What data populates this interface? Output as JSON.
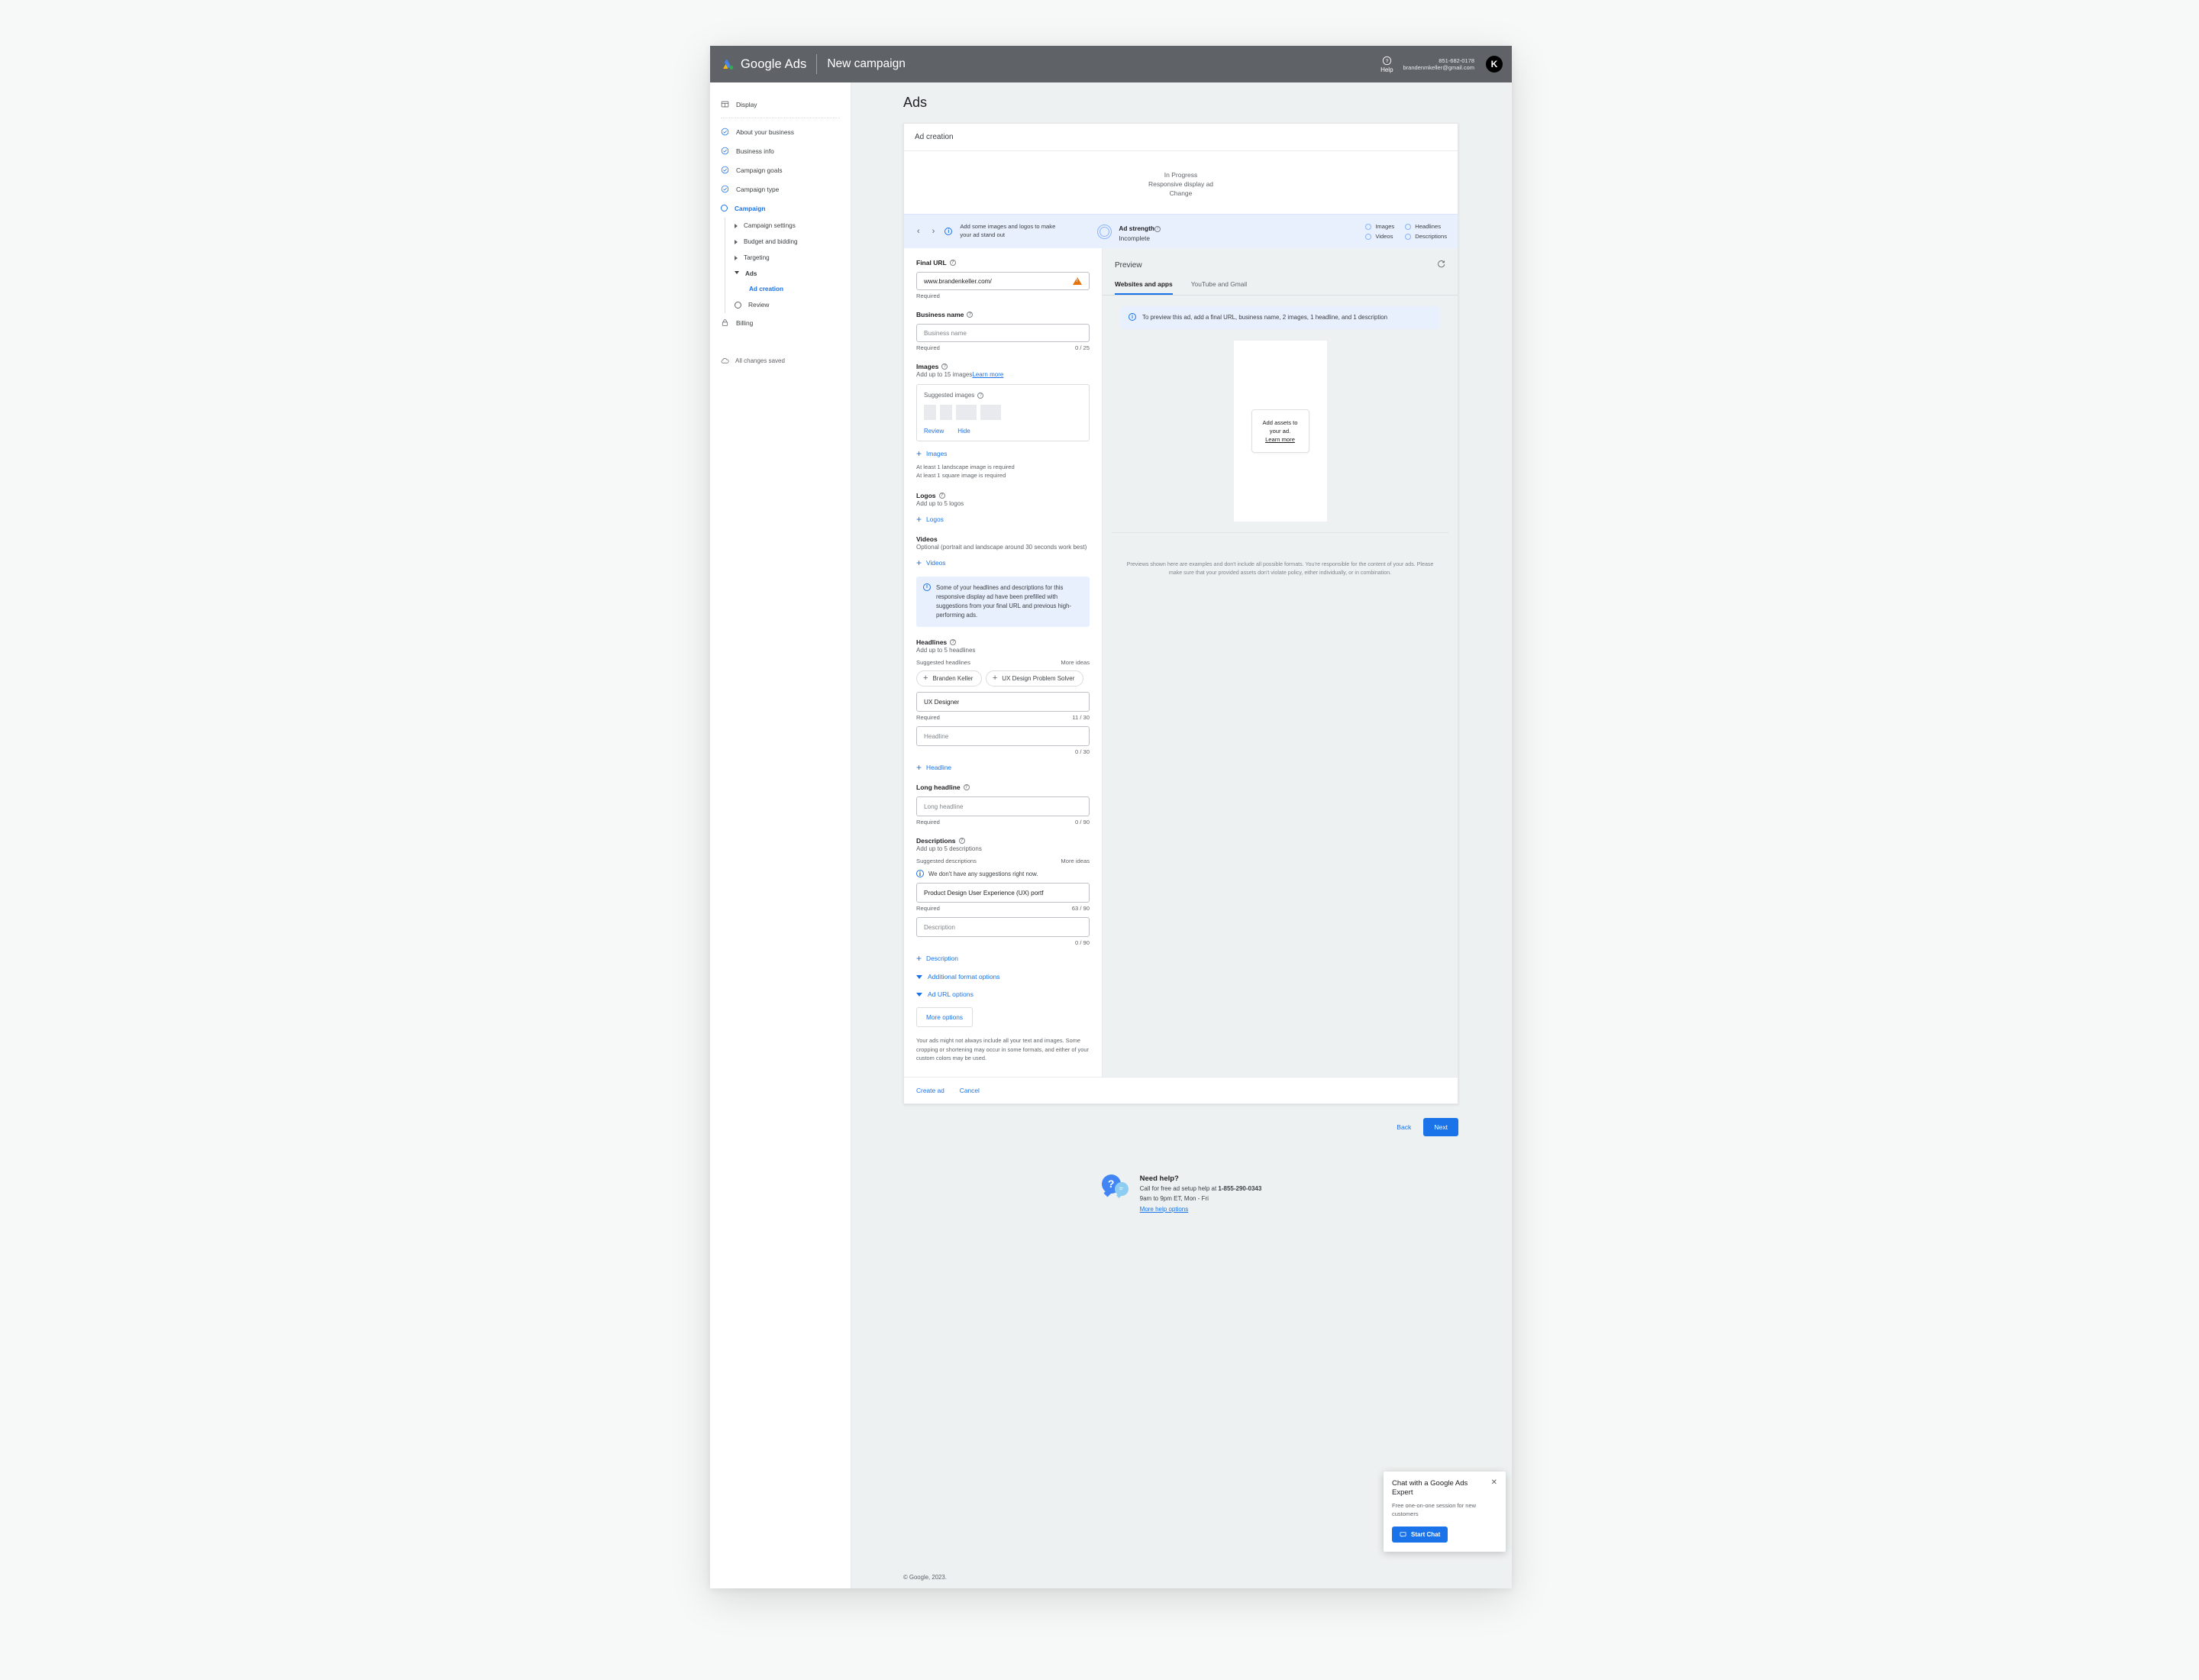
{
  "topbar": {
    "brand_google": "Google",
    "brand_ads": "Ads",
    "campaign_title": "New campaign",
    "help_label": "Help",
    "phone": "851-682-0178",
    "email": "brandenmkeller@gmail.com",
    "avatar_initial": "K"
  },
  "sidebar": {
    "display": "Display",
    "items": [
      {
        "label": "About your business",
        "icon": "check-circle-icon",
        "state": "complete"
      },
      {
        "label": "Business info",
        "icon": "check-circle-icon",
        "state": "complete"
      },
      {
        "label": "Campaign goals",
        "icon": "check-circle-icon",
        "state": "complete"
      },
      {
        "label": "Campaign type",
        "icon": "check-circle-icon",
        "state": "complete"
      },
      {
        "label": "Campaign",
        "icon": "circle-icon",
        "state": "active"
      }
    ],
    "sub_items": [
      {
        "label": "Campaign settings"
      },
      {
        "label": "Budget and bidding"
      },
      {
        "label": "Targeting"
      },
      {
        "label": "Ads"
      }
    ],
    "sub_child": "Ad creation",
    "review": "Review",
    "billing": "Billing",
    "saved_status": "All changes saved"
  },
  "main": {
    "page_title": "Ads",
    "card_title": "Ad creation",
    "status_progress": "In Progress",
    "status_type": "Responsive display ad",
    "status_change": "Change",
    "strength": {
      "message": "Add some images and logos to make your ad stand out",
      "title": "Ad strength",
      "value": "Incomplete",
      "checks": [
        "Images",
        "Headlines",
        "Videos",
        "Descriptions"
      ]
    }
  },
  "form": {
    "final_url_label": "Final URL",
    "final_url_value": "www.brandenkeller.com/",
    "final_url_required": "Required",
    "business_name_label": "Business name",
    "business_name_placeholder": "Business name",
    "business_name_required": "Required",
    "business_name_count": "0 / 25",
    "images_label": "Images",
    "images_sub": "Add up to 15 images",
    "images_learn_more": "Learn more",
    "suggested_images_label": "Suggested images",
    "suggested_review": "Review",
    "suggested_hide": "Hide",
    "add_images": "Images",
    "images_hint_1": "At least 1 landscape image is required",
    "images_hint_2": "At least 1 square image is required",
    "logos_label": "Logos",
    "logos_sub": "Add up to 5 logos",
    "add_logos": "Logos",
    "videos_label": "Videos",
    "videos_sub": "Optional (portrait and landscape around 30 seconds work best)",
    "add_videos": "Videos",
    "prefill_notice": "Some of your headlines and descriptions for this responsive display ad have been prefilled with suggestions from your final URL and previous high-performing ads.",
    "headlines_label": "Headlines",
    "headlines_sub": "Add up to 5 headlines",
    "suggested_headlines_label": "Suggested headlines",
    "more_ideas": "More ideas",
    "headline_chips": [
      "Branden Keller",
      "UX Design Problem Solver"
    ],
    "headline_value": "UX Designer",
    "headline_required": "Required",
    "headline_count": "11 / 30",
    "headline_placeholder": "Headline",
    "headline_empty_count": "0 / 30",
    "add_headline": "Headline",
    "long_headline_label": "Long headline",
    "long_headline_placeholder": "Long headline",
    "long_headline_required": "Required",
    "long_headline_count": "0 / 90",
    "descriptions_label": "Descriptions",
    "descriptions_sub": "Add up to 5 descriptions",
    "suggested_descriptions_label": "Suggested descriptions",
    "no_suggestions": "We don't have any suggestions right now.",
    "description_value": "Product Design User Experience (UX) portf",
    "description_required": "Required",
    "description_count": "63 / 90",
    "description_placeholder": "Description",
    "description_empty_count": "0 / 90",
    "add_description": "Description",
    "additional_format_options": "Additional format options",
    "ad_url_options": "Ad URL options",
    "more_options": "More options",
    "legalese": "Your ads might not always include all your text and images. Some cropping or shortening may occur in some formats, and either of your custom colors may be used."
  },
  "preview": {
    "title": "Preview",
    "tabs": [
      "Websites and apps",
      "YouTube and Gmail"
    ],
    "active_tab": "Websites and apps",
    "notice": "To preview this ad, add a final URL, business name, 2 images, 1 headline, and 1 description",
    "assets_line_1": "Add assets to",
    "assets_line_2": "your ad.",
    "assets_learn_more": "Learn more",
    "disclaimer": "Previews shown here are examples and don't include all possible formats. You're responsible for the content of your ads. Please make sure that your provided assets don't violate policy, either individually, or in combination."
  },
  "actions": {
    "create_ad": "Create ad",
    "cancel": "Cancel",
    "back": "Back",
    "next": "Next"
  },
  "help_strip": {
    "title": "Need help?",
    "line_1_prefix": "Call for free ad setup help at ",
    "phone": "1-855-290-0343",
    "line_2": "9am to 9pm ET, Mon - Fri",
    "more_help": "More help options"
  },
  "chat": {
    "title": "Chat with a Google Ads Expert",
    "subtitle": "Free one-on-one session for new customers",
    "button": "Start Chat"
  },
  "footer": {
    "copyright": "© Google, 2023."
  },
  "colors": {
    "accent": "#1a73e8",
    "topbar": "#5f6368",
    "notice_bg": "#e8f0fe",
    "warning": "#e8710a"
  }
}
